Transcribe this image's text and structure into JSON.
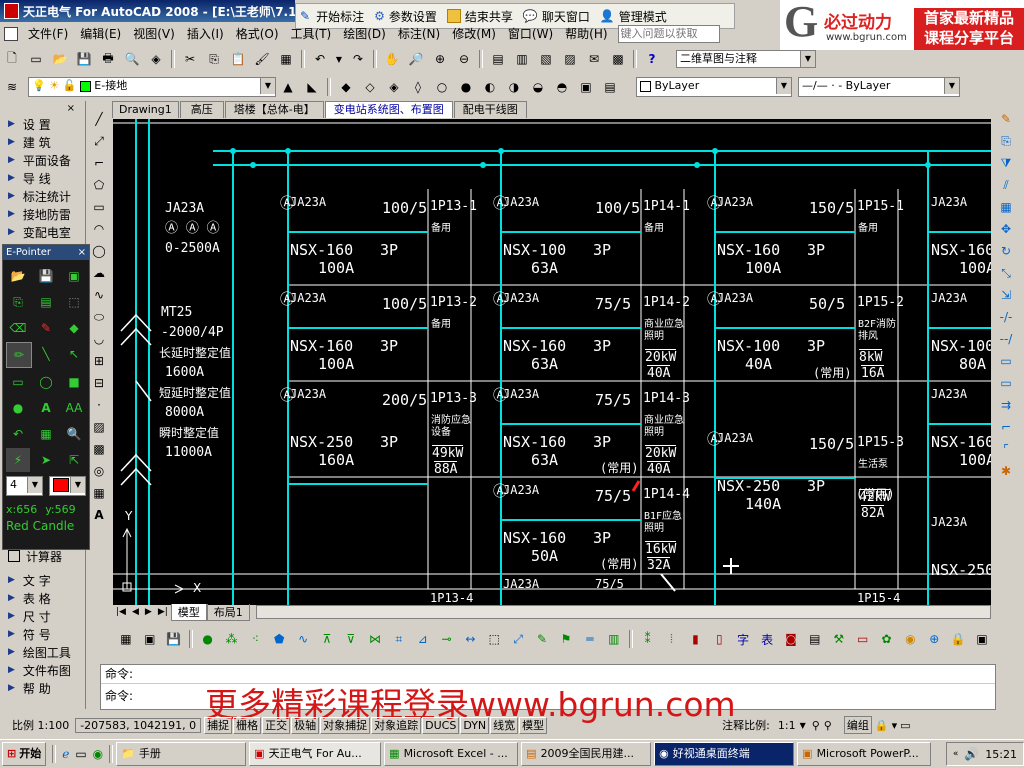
{
  "window": {
    "title": "天正电气 For AutoCAD 2008 - [E:\\王老师\\7.13列"
  },
  "floating_toolbar": {
    "items": [
      {
        "icon": "pen-icon",
        "label": "开始标注"
      },
      {
        "icon": "gear-icon",
        "label": "参数设置"
      },
      {
        "icon": "stop-icon",
        "label": "结束共享"
      },
      {
        "icon": "chat-icon",
        "label": "聊天窗口"
      },
      {
        "icon": "user-icon",
        "label": "管理模式"
      }
    ]
  },
  "watermark": {
    "logo_letter": "G",
    "brand": "必过动力",
    "url": "www.bgrun.com",
    "promo1": "首家最新精品",
    "promo2": "课程分享平台",
    "bottom": "更多精彩课程登录www.bgrun.com"
  },
  "menu": [
    "文件(F)",
    "编辑(E)",
    "视图(V)",
    "插入(I)",
    "格式(O)",
    "工具(T)",
    "绘图(D)",
    "标注(N)",
    "修改(M)",
    "窗口(W)",
    "帮助(H)"
  ],
  "help_search": {
    "placeholder": "键入问题以获取"
  },
  "workspace": {
    "value": "二维草图与注释"
  },
  "layer": {
    "value": "E-接地"
  },
  "color": {
    "value": "ByLayer"
  },
  "linetype": {
    "value": "—/— · - ByLayer"
  },
  "sidebar": {
    "items_top": [
      "设  置",
      "建  筑",
      "平面设备",
      "导  线",
      "标注统计",
      "接地防雷",
      "变配电室"
    ],
    "items_bottom": [
      "计算器",
      "文  字",
      "表  格",
      "尺  寸",
      "符  号",
      "绘图工具",
      "文件布图",
      "帮  助"
    ]
  },
  "epointer": {
    "title": "E-Pointer",
    "width": "4",
    "coord_x": "x:656",
    "coord_y": "y:569",
    "color_name": "Red Candle"
  },
  "drawing_tabs": [
    "Drawing1",
    "高压",
    "塔楼【总体-电】",
    "变电站系统图、布置图",
    "配电干线图"
  ],
  "active_tab": "变电站系统图、布置图",
  "layout_tabs": [
    "模型",
    "布局1"
  ],
  "cad": {
    "main_breaker": {
      "code": "JA23A",
      "rating": "0-2500A",
      "model": "MT25",
      "spec": "-2000/4P",
      "l1": "长延时整定值",
      "v1": "1600A",
      "l2": "短延时整定值",
      "v2": "8000A",
      "l3": "瞬时整定值",
      "v3": "11000A"
    },
    "axis": {
      "y": "Y",
      "x": "X"
    },
    "circuits": [
      {
        "code": "JA23A",
        "ct": "100/5",
        "model": "NSX-160",
        "amp": "100A",
        "poles": "3P",
        "id": "1P13-1",
        "desc": "备用"
      },
      {
        "code": "JA23A",
        "ct": "100/5",
        "model": "NSX-160",
        "amp": "100A",
        "poles": "3P",
        "id": "1P13-2",
        "desc": "备用"
      },
      {
        "code": "JA23A",
        "ct": "200/5",
        "model": "NSX-250",
        "amp": "160A",
        "poles": "3P",
        "id": "1P13-3",
        "desc": "消防应急设备",
        "load": "49kW",
        "cur": "88A"
      },
      {
        "code": "JA23A",
        "ct": "100/5",
        "model": "NSX-100",
        "amp": "63A",
        "poles": "3P",
        "id": "1P14-1",
        "desc": "备用"
      },
      {
        "code": "JA23A",
        "ct": "75/5",
        "model": "NSX-160",
        "amp": "63A",
        "poles": "3P",
        "id": "1P14-2",
        "desc": "商业应急照明",
        "load": "20kW",
        "cur": "40A"
      },
      {
        "code": "JA23A",
        "ct": "75/5",
        "model": "NSX-160",
        "amp": "63A",
        "poles": "3P",
        "id": "1P14-3",
        "desc": "商业应急照明",
        "load": "20kW",
        "cur": "40A"
      },
      {
        "code": "JA23A",
        "ct": "75/5",
        "model": "NSX-160",
        "amp": "50A",
        "poles": "3P",
        "id": "1P14-4",
        "desc": "B1F应急照明",
        "load": "16kW",
        "cur": "32A"
      },
      {
        "code": "JA23A",
        "ct": "150/5",
        "model": "NSX-160",
        "amp": "100A",
        "poles": "3P",
        "id": "1P15-1",
        "desc": "备用"
      },
      {
        "code": "JA23A",
        "ct": "50/5",
        "model": "NSX-100",
        "amp": "40A",
        "poles": "3P",
        "id": "1P15-2",
        "desc": "B2F消防排风",
        "load": "8kW",
        "cur": "16A"
      },
      {
        "code": "JA23A",
        "ct": "150/5",
        "model": "NSX-250",
        "amp": "140A",
        "poles": "3P",
        "id": "1P15-3",
        "desc": "生活泵",
        "load": "42kW",
        "cur": "82A"
      }
    ],
    "partial": [
      {
        "code": "JA23A",
        "model": "NSX-160",
        "amp": "100A"
      },
      {
        "code": "JA23A",
        "model": "NSX-100",
        "amp": "80A"
      },
      {
        "code": "JA23A",
        "model": "NSX-160",
        "amp": "100A"
      },
      {
        "code": "JA23A",
        "model": "NSX-250"
      }
    ],
    "bottom_ids": [
      "1P13-4",
      "1P15-4"
    ],
    "bottom_ct": "75/5",
    "bottom_code": "JA23A",
    "usage_tag": "(常用)"
  },
  "command": {
    "prompt1": "命令:",
    "prompt2": "命令:"
  },
  "status": {
    "scale": "比例 1:100",
    "coords": "-207583, 1042191, 0",
    "toggles": [
      "捕捉",
      "栅格",
      "正交",
      "极轴",
      "对象捕捉",
      "对象追踪",
      "DUCS",
      "DYN",
      "线宽",
      "模型"
    ],
    "anno_label": "注释比例:",
    "anno_value": "1:1",
    "group": "编组"
  },
  "taskbar": {
    "start": "开始",
    "items": [
      "手册",
      "天正电气 For Au...",
      "Microsoft Excel - ...",
      "2009全国民用建...",
      "好视通桌面终端",
      "Microsoft PowerP..."
    ],
    "clock": "15:21"
  }
}
